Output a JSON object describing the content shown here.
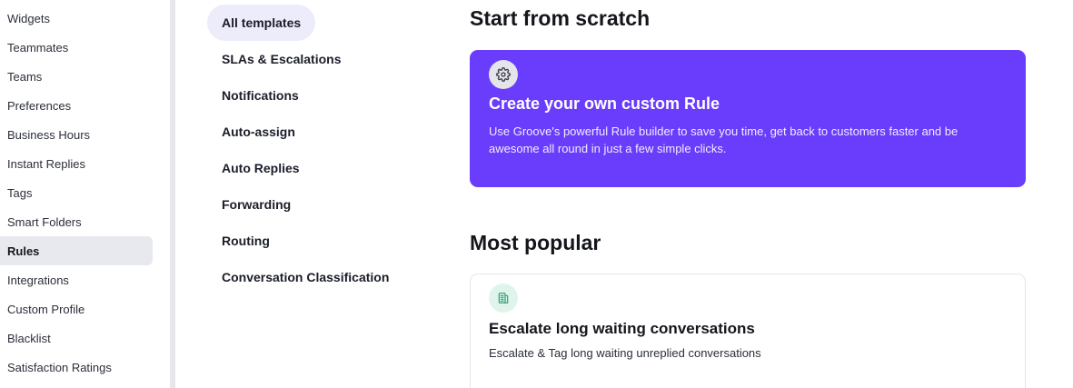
{
  "sidebar": {
    "items": [
      {
        "label": "Widgets"
      },
      {
        "label": "Teammates"
      },
      {
        "label": "Teams"
      },
      {
        "label": "Preferences"
      },
      {
        "label": "Business Hours"
      },
      {
        "label": "Instant Replies"
      },
      {
        "label": "Tags"
      },
      {
        "label": "Smart Folders"
      },
      {
        "label": "Rules",
        "active": true
      },
      {
        "label": "Integrations"
      },
      {
        "label": "Custom Profile"
      },
      {
        "label": "Blacklist"
      },
      {
        "label": "Satisfaction Ratings"
      }
    ]
  },
  "categories": {
    "items": [
      {
        "label": "All templates",
        "active": true
      },
      {
        "label": "SLAs & Escalations"
      },
      {
        "label": "Notifications"
      },
      {
        "label": "Auto-assign"
      },
      {
        "label": "Auto Replies"
      },
      {
        "label": "Forwarding"
      },
      {
        "label": "Routing"
      },
      {
        "label": "Conversation Classification"
      }
    ]
  },
  "scratch": {
    "heading": "Start from scratch",
    "card": {
      "icon": "gear-icon",
      "title": "Create your own custom Rule",
      "description": "Use Groove's powerful Rule builder to save you time, get back to customers faster and be awesome all round in just a few simple clicks."
    }
  },
  "popular": {
    "heading": "Most popular",
    "card": {
      "icon": "escalate-icon",
      "title": "Escalate long waiting conversations",
      "description": "Escalate & Tag long waiting unreplied conversations"
    }
  },
  "colors": {
    "accent": "#6a3cfb",
    "active_sidebar": "#e8e9ee",
    "active_category": "#ececfb",
    "popular_icon_bg": "#dff5ec",
    "popular_icon_fg": "#2f9f72"
  }
}
